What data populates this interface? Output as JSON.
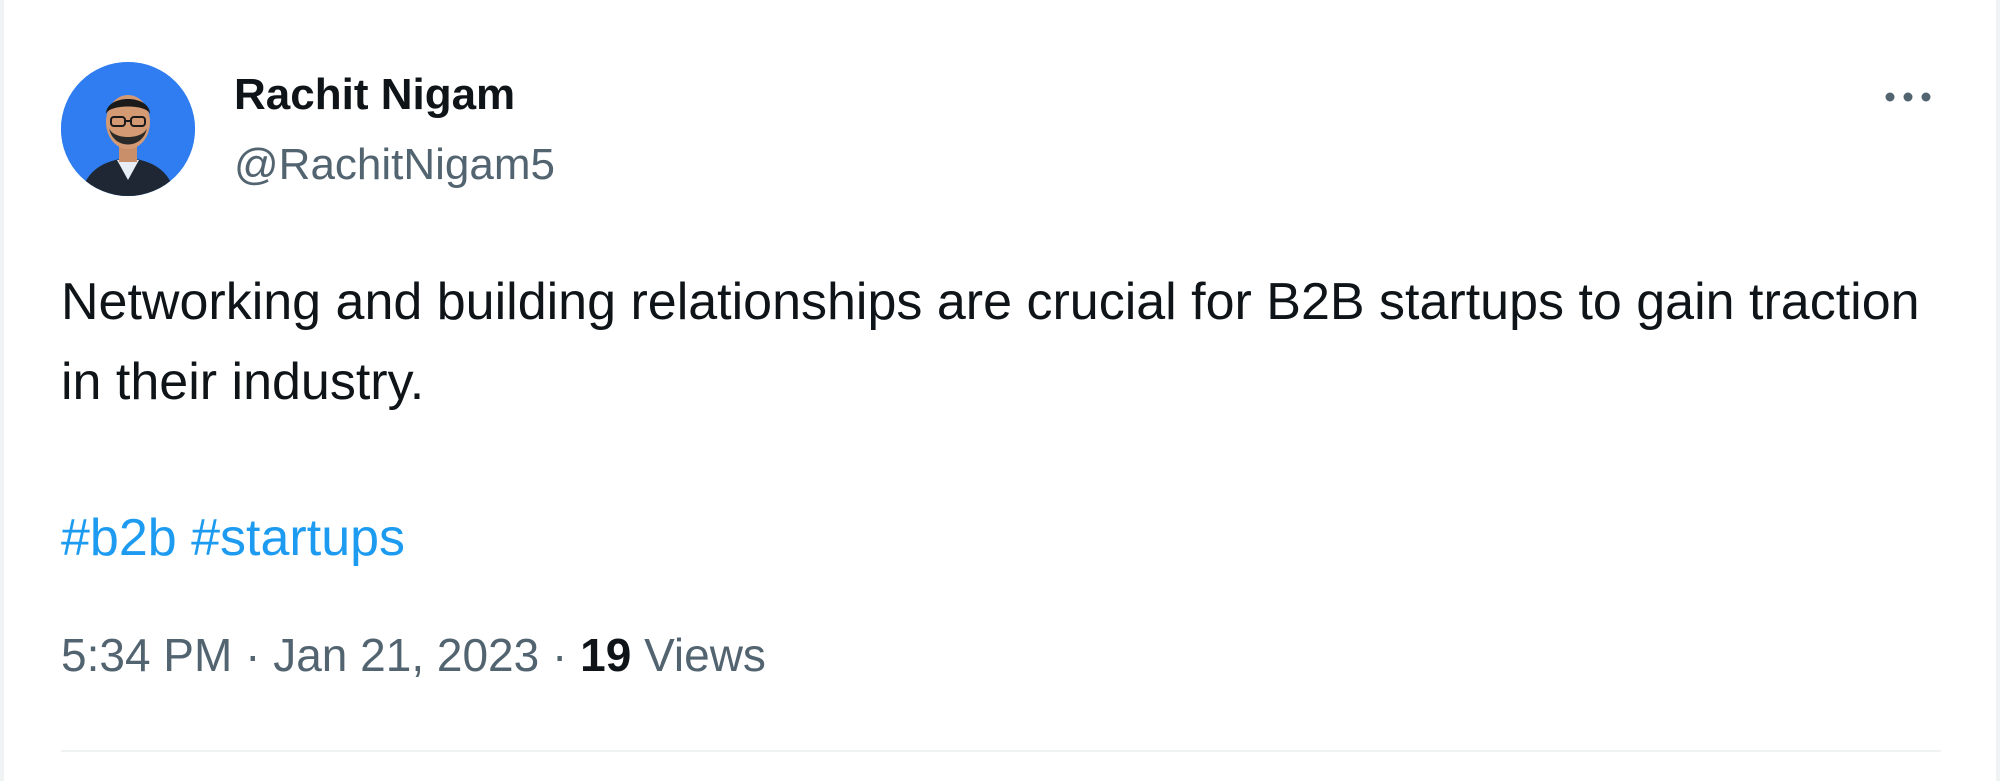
{
  "tweet": {
    "author": {
      "display_name": "Rachit Nigam",
      "handle": "@RachitNigam5",
      "avatar_icon": "user-avatar"
    },
    "more_icon": "more-horizontal-icon",
    "text": "Networking and building relationships are crucial for B2B startups to gain traction in their industry.",
    "hashtags": [
      "#b2b",
      "#startups"
    ],
    "meta": {
      "time": "5:34 PM",
      "separator": "·",
      "date": "Jan 21, 2023",
      "views_count": "19",
      "views_label": "Views"
    }
  },
  "colors": {
    "text_primary": "#0f1419",
    "text_secondary": "#536471",
    "link": "#1d9bf0",
    "avatar_bg": "#2f7df0"
  }
}
